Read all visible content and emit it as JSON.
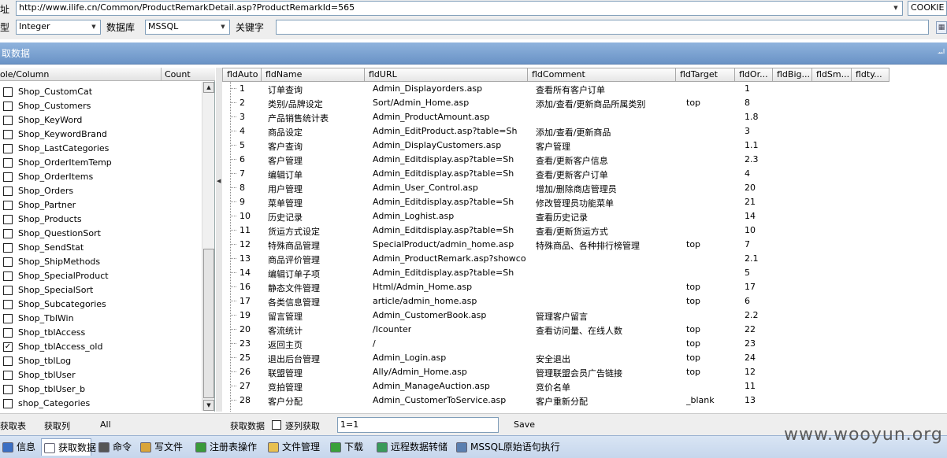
{
  "url_row": {
    "label": "址",
    "url": "http://www.ilife.cn/Common/ProductRemarkDetail.asp?ProductRemarkId=565",
    "cookie_label": "COOKIE"
  },
  "params_row": {
    "type_label": "型",
    "type_value": "Integer",
    "db_label": "数据库",
    "db_value": "MSSQL",
    "keyword_label": "关键字",
    "keyword_value": ""
  },
  "title_bar": {
    "title": "取数据",
    "pin": "ᆈ"
  },
  "left_panel": {
    "col_table": "ole/Column",
    "col_count": "Count",
    "items": [
      {
        "name": "Shop_CustomCat",
        "checked": false
      },
      {
        "name": "Shop_Customers",
        "checked": false
      },
      {
        "name": "Shop_KeyWord",
        "checked": false
      },
      {
        "name": "Shop_KeywordBrand",
        "checked": false
      },
      {
        "name": "Shop_LastCategories",
        "checked": false
      },
      {
        "name": "Shop_OrderItemTemp",
        "checked": false
      },
      {
        "name": "Shop_OrderItems",
        "checked": false
      },
      {
        "name": "Shop_Orders",
        "checked": false
      },
      {
        "name": "Shop_Partner",
        "checked": false
      },
      {
        "name": "Shop_Products",
        "checked": false
      },
      {
        "name": "Shop_QuestionSort",
        "checked": false
      },
      {
        "name": "Shop_SendStat",
        "checked": false
      },
      {
        "name": "Shop_ShipMethods",
        "checked": false
      },
      {
        "name": "Shop_SpecialProduct",
        "checked": false
      },
      {
        "name": "Shop_SpecialSort",
        "checked": false
      },
      {
        "name": "Shop_Subcategories",
        "checked": false
      },
      {
        "name": "Shop_TblWin",
        "checked": false
      },
      {
        "name": "Shop_tblAccess",
        "checked": false
      },
      {
        "name": "Shop_tblAccess_old",
        "checked": true
      },
      {
        "name": "Shop_tblLog",
        "checked": false
      },
      {
        "name": "Shop_tblUser",
        "checked": false
      },
      {
        "name": "Shop_tblUser_b",
        "checked": false
      },
      {
        "name": "shop_Categories",
        "checked": false
      }
    ]
  },
  "grid": {
    "columns": [
      "fldAuto",
      "fldName",
      "fldURL",
      "fldComment",
      "fldTarget",
      "fldOr...",
      "fldBig...",
      "fldSm...",
      "fldty..."
    ],
    "rows": [
      [
        "1",
        "订单查询",
        "Admin_Displayorders.asp",
        "查看所有客户订单",
        "",
        "1"
      ],
      [
        "2",
        "类别/品牌设定",
        "Sort/Admin_Home.asp",
        "添加/查看/更新商品所属类别",
        "top",
        "8"
      ],
      [
        "3",
        "产品销售统计表",
        "Admin_ProductAmount.asp",
        "",
        "",
        "1.8"
      ],
      [
        "4",
        "商品设定",
        "Admin_EditProduct.asp?table=Sh",
        "添加/查看/更新商品",
        "",
        "3"
      ],
      [
        "5",
        "客户查询",
        "Admin_DisplayCustomers.asp",
        "客户管理",
        "",
        "1.1"
      ],
      [
        "6",
        "客户管理",
        "Admin_Editdisplay.asp?table=Sh",
        "查看/更新客户信息",
        "",
        "2.3"
      ],
      [
        "7",
        "编辑订单",
        "Admin_Editdisplay.asp?table=Sh",
        "查看/更新客户订单",
        "",
        "4"
      ],
      [
        "8",
        "用户管理",
        "Admin_User_Control.asp",
        "增加/删除商店管理员",
        "",
        "20"
      ],
      [
        "9",
        "菜单管理",
        "Admin_Editdisplay.asp?table=Sh",
        "修改管理员功能菜单",
        "",
        "21"
      ],
      [
        "10",
        "历史记录",
        "Admin_Loghist.asp",
        "查看历史记录",
        "",
        "14"
      ],
      [
        "11",
        "货运方式设定",
        "Admin_Editdisplay.asp?table=Sh",
        "查看/更新货运方式",
        "",
        "10"
      ],
      [
        "12",
        "特殊商品管理",
        "SpecialProduct/admin_home.asp",
        "特殊商品、各种排行榜管理",
        "top",
        "7"
      ],
      [
        "13",
        "商品评价管理",
        "Admin_ProductRemark.asp?showco",
        "",
        "",
        "2.1"
      ],
      [
        "14",
        "编辑订单子项",
        "Admin_Editdisplay.asp?table=Sh",
        "",
        "",
        "5"
      ],
      [
        "16",
        "静态文件管理",
        "Html/Admin_Home.asp",
        "",
        "top",
        "17"
      ],
      [
        "17",
        "各类信息管理",
        "article/admin_home.asp",
        "",
        "top",
        "6"
      ],
      [
        "19",
        "留言管理",
        "Admin_CustomerBook.asp",
        "管理客户留言",
        "",
        "2.2"
      ],
      [
        "20",
        "客流统计",
        "/Icounter",
        "查看访问量、在线人数",
        "top",
        "22"
      ],
      [
        "23",
        "返回主页",
        "/",
        "",
        "top",
        "23"
      ],
      [
        "25",
        "退出后台管理",
        "Admin_Login.asp",
        "安全退出",
        "top",
        "24"
      ],
      [
        "26",
        "联盟管理",
        "Ally/Admin_Home.asp",
        "管理联盟会员广告链接",
        "top",
        "12"
      ],
      [
        "27",
        "竞拍管理",
        "Admin_ManageAuction.asp",
        "竞价名单",
        "",
        "11"
      ],
      [
        "28",
        "客户分配",
        "Admin_CustomerToService.asp",
        "客户重新分配",
        "_blank",
        "13"
      ]
    ]
  },
  "action_bar": {
    "get_tables": "获取表",
    "get_columns": "获取列",
    "all": "All",
    "get_data": "获取数据",
    "row_by_row": "逐列获取",
    "condition": "1=1",
    "save": "Save"
  },
  "tabs": [
    {
      "label": "信息",
      "icon": "info-icon",
      "color": "#3a6fc4"
    },
    {
      "label": "获取数据",
      "icon": "data-icon",
      "color": "#ffffff"
    },
    {
      "label": "命令",
      "icon": "command-icon",
      "color": "#555555"
    },
    {
      "label": "写文件",
      "icon": "write-file-icon",
      "color": "#d9a53a"
    },
    {
      "label": "注册表操作",
      "icon": "registry-icon",
      "color": "#3a9a3a"
    },
    {
      "label": "文件管理",
      "icon": "folder-icon",
      "color": "#e8c050"
    },
    {
      "label": "下载",
      "icon": "download-icon",
      "color": "#3aa03a"
    },
    {
      "label": "远程数据转储",
      "icon": "globe-icon",
      "color": "#3a9a5a"
    },
    {
      "label": "MSSQL原始语句执行",
      "icon": "sql-icon",
      "color": "#5a7fb0"
    }
  ],
  "watermark": "www.wooyun.org"
}
